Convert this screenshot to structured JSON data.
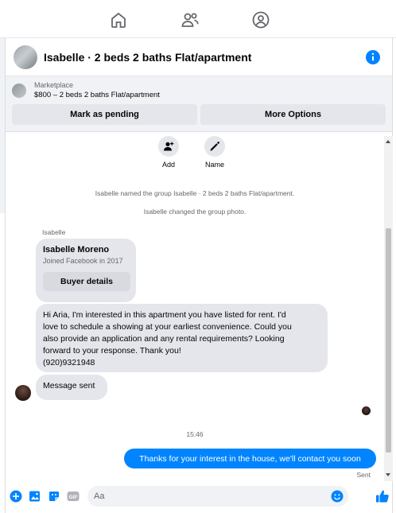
{
  "colors": {
    "accent": "#0084ff",
    "bubble_gray": "#e4e6eb",
    "panel_gray": "#f0f2f5",
    "muted_text": "#65676b"
  },
  "topnav": {
    "icons": [
      "home-icon",
      "people-icon",
      "groups-icon"
    ]
  },
  "header": {
    "title": "Isabelle · 2 beds 2 baths Flat/apartment"
  },
  "marketplace": {
    "label": "Marketplace",
    "listing": "$800 – 2 beds 2 baths Flat/apartment",
    "pending_label": "Mark as pending",
    "more_label": "More Options"
  },
  "actions": [
    {
      "label": "Add",
      "icon": "add-person-icon"
    },
    {
      "label": "Name",
      "icon": "pencil-icon"
    }
  ],
  "system_messages": [
    "Isabelle named the group Isabelle · 2 beds 2 baths Flat/apartment.",
    "Isabelle changed the group photo."
  ],
  "sender": "Isabelle",
  "profile_card": {
    "name": "Isabelle Moreno",
    "subtitle": "Joined Facebook in 2017",
    "button_label": "Buyer details"
  },
  "incoming_message": {
    "lines": [
      "Hi Aria, I'm interested in this apartment you have listed for rent. I'd",
      "love to schedule a showing at your earliest convenience. Could you",
      "also provide an application and any rental requirements? Looking",
      "forward to your response. Thank you!",
      "(920)9321948"
    ]
  },
  "auto_message": "Message sent",
  "timestamp": "15:46",
  "outgoing_message": "Thanks for your interest in the house, we'll contact you soon",
  "status": "Sent",
  "composer": {
    "placeholder": "Aa",
    "icons": [
      "plus-circle-icon",
      "photo-icon",
      "sticker-icon",
      "gif-icon"
    ]
  }
}
